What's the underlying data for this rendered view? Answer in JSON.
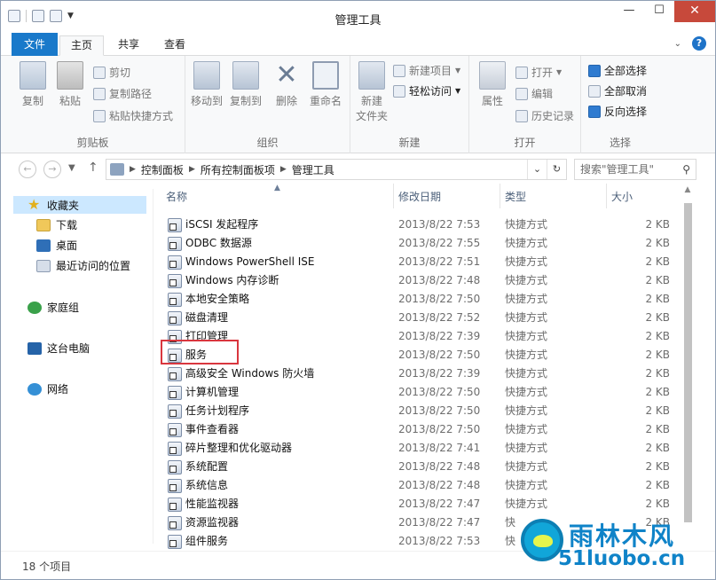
{
  "window": {
    "title": "管理工具",
    "controls": {
      "minimize": "—",
      "maximize": "☐",
      "close": "✕"
    }
  },
  "ribbon_tabs": [
    "文件",
    "主页",
    "共享",
    "查看"
  ],
  "ribbon": {
    "clipboard": {
      "label": "剪贴板",
      "copy": "复制",
      "paste": "粘贴",
      "cut": "剪切",
      "copy_path": "复制路径",
      "paste_shortcut": "粘贴快捷方式"
    },
    "organize": {
      "label": "组织",
      "move_to": "移动到",
      "copy_to": "复制到",
      "delete": "删除",
      "rename": "重命名"
    },
    "new": {
      "label": "新建",
      "new_folder": "新建\n文件夹",
      "new_item": "新建项目",
      "easy_access": "轻松访问"
    },
    "open": {
      "label": "打开",
      "properties": "属性",
      "open": "打开",
      "edit": "编辑",
      "history": "历史记录"
    },
    "select": {
      "label": "选择",
      "select_all": "全部选择",
      "select_none": "全部取消",
      "invert": "反向选择"
    }
  },
  "address": {
    "crumbs": [
      "控制面板",
      "所有控制面板项",
      "管理工具"
    ],
    "search_placeholder": "搜索\"管理工具\""
  },
  "nav_pane": {
    "favorites": "收藏夹",
    "downloads": "下载",
    "desktop": "桌面",
    "recent": "最近访问的位置",
    "homegroup": "家庭组",
    "this_pc": "这台电脑",
    "network": "网络"
  },
  "columns": {
    "name": "名称",
    "date": "修改日期",
    "type": "类型",
    "size": "大小"
  },
  "files": [
    {
      "name": "iSCSI 发起程序",
      "date": "2013/8/22 7:53",
      "type": "快捷方式",
      "size": "2 KB"
    },
    {
      "name": "ODBC 数据源",
      "date": "2013/8/22 7:55",
      "type": "快捷方式",
      "size": "2 KB"
    },
    {
      "name": "Windows PowerShell ISE",
      "date": "2013/8/22 7:51",
      "type": "快捷方式",
      "size": "2 KB"
    },
    {
      "name": "Windows 内存诊断",
      "date": "2013/8/22 7:48",
      "type": "快捷方式",
      "size": "2 KB"
    },
    {
      "name": "本地安全策略",
      "date": "2013/8/22 7:50",
      "type": "快捷方式",
      "size": "2 KB"
    },
    {
      "name": "磁盘清理",
      "date": "2013/8/22 7:52",
      "type": "快捷方式",
      "size": "2 KB"
    },
    {
      "name": "打印管理",
      "date": "2013/8/22 7:39",
      "type": "快捷方式",
      "size": "2 KB"
    },
    {
      "name": "服务",
      "date": "2013/8/22 7:50",
      "type": "快捷方式",
      "size": "2 KB"
    },
    {
      "name": "高级安全 Windows 防火墙",
      "date": "2013/8/22 7:39",
      "type": "快捷方式",
      "size": "2 KB"
    },
    {
      "name": "计算机管理",
      "date": "2013/8/22 7:50",
      "type": "快捷方式",
      "size": "2 KB"
    },
    {
      "name": "任务计划程序",
      "date": "2013/8/22 7:50",
      "type": "快捷方式",
      "size": "2 KB"
    },
    {
      "name": "事件查看器",
      "date": "2013/8/22 7:50",
      "type": "快捷方式",
      "size": "2 KB"
    },
    {
      "name": "碎片整理和优化驱动器",
      "date": "2013/8/22 7:41",
      "type": "快捷方式",
      "size": "2 KB"
    },
    {
      "name": "系统配置",
      "date": "2013/8/22 7:48",
      "type": "快捷方式",
      "size": "2 KB"
    },
    {
      "name": "系统信息",
      "date": "2013/8/22 7:48",
      "type": "快捷方式",
      "size": "2 KB"
    },
    {
      "name": "性能监视器",
      "date": "2013/8/22 7:47",
      "type": "快捷方式",
      "size": "2 KB"
    },
    {
      "name": "资源监视器",
      "date": "2013/8/22 7:47",
      "type": "快",
      "size": "2 KB"
    },
    {
      "name": "组件服务",
      "date": "2013/8/22 7:53",
      "type": "快",
      "size": ""
    }
  ],
  "status": {
    "item_count": "18 个项目"
  },
  "watermark": {
    "cn": "雨林木风",
    "url": "51luobo.cn"
  },
  "colors": {
    "accent": "#1979ca",
    "highlight_box": "#d9363e",
    "close_button": "#c7493b"
  }
}
